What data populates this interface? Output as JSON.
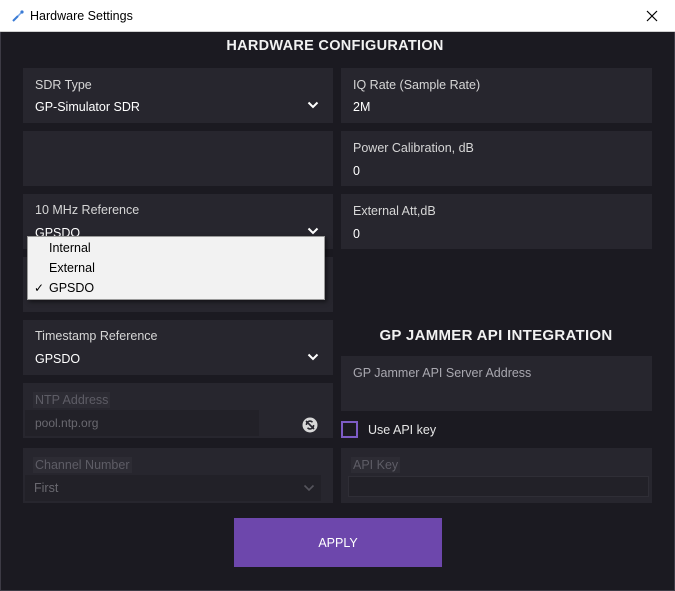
{
  "window": {
    "title": "Hardware Settings"
  },
  "headings": {
    "main": "HARDWARE CONFIGURATION",
    "api": "GP JAMMER API INTEGRATION"
  },
  "sdr_type": {
    "label": "SDR Type",
    "value": "GP-Simulator SDR"
  },
  "iq_rate": {
    "label": "IQ Rate (Sample Rate)",
    "value": "2M"
  },
  "power_calibration": {
    "label": "Power Calibration, dB",
    "value": "0"
  },
  "ref_10mhz": {
    "label": "10 MHz Reference",
    "value": "GPSDO",
    "options": [
      "Internal",
      "External",
      "GPSDO"
    ],
    "selected": "GPSDO"
  },
  "external_att": {
    "label": "External Att,dB",
    "value": "0"
  },
  "timestamp_ref": {
    "label": "Timestamp Reference",
    "value": "GPSDO"
  },
  "ntp": {
    "label": "NTP Address",
    "value": "pool.ntp.org"
  },
  "channel": {
    "label": "Channel Number",
    "value": "First"
  },
  "api": {
    "server_label": "GP Jammer API Server Address",
    "use_key_label": "Use API key",
    "key_label": "API Key"
  },
  "apply_label": "APPLY",
  "colors": {
    "accent": "#6d47ac",
    "checkbox_border": "#7d5cc6",
    "background": "#1b1a21",
    "panel": "#27262e"
  }
}
